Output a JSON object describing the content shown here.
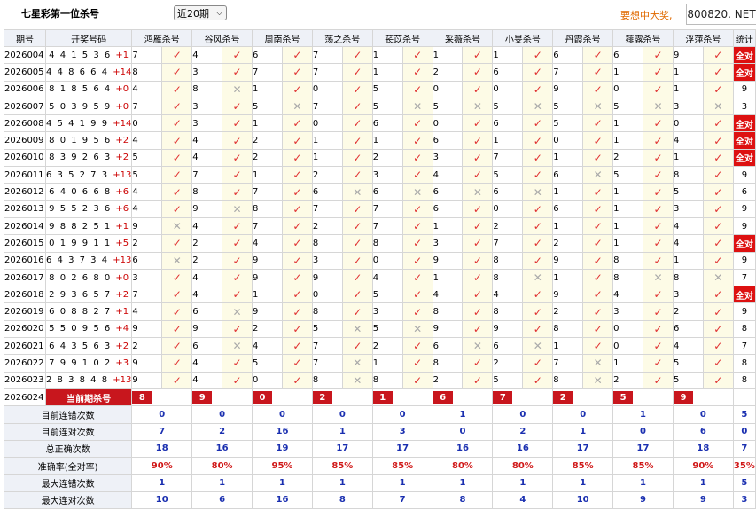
{
  "header": {
    "title": "七星彩第一位杀号",
    "period_select": "近20期",
    "ad_link": "要想中大奖,",
    "ad_badge": "800820. NET"
  },
  "columns": {
    "period": "期号",
    "draw": "开奖号码",
    "experts": [
      "鸿雁杀号",
      "谷风杀号",
      "周南杀号",
      "荡之杀号",
      "苌苡杀号",
      "采薇杀号",
      "小旻杀号",
      "丹霞杀号",
      "薤露杀号",
      "浮萍杀号"
    ],
    "stats": "统计"
  },
  "rows": [
    {
      "period": "2026004",
      "draw": "4 4 1 5 3 6",
      "plus": "+1",
      "nums": [
        7,
        4,
        6,
        7,
        1,
        1,
        1,
        6,
        6,
        9
      ],
      "marks": [
        1,
        1,
        1,
        1,
        1,
        1,
        1,
        1,
        1,
        1
      ],
      "stat": "全对"
    },
    {
      "period": "2026005",
      "draw": "4 4 8 6 6 4",
      "plus": "+14",
      "nums": [
        8,
        3,
        7,
        7,
        1,
        2,
        6,
        7,
        1,
        1
      ],
      "marks": [
        1,
        1,
        1,
        1,
        1,
        1,
        1,
        1,
        1,
        1
      ],
      "stat": "全对"
    },
    {
      "period": "2026006",
      "draw": "8 1 8 5 6 4",
      "plus": "+0",
      "nums": [
        4,
        8,
        1,
        0,
        5,
        0,
        0,
        9,
        0,
        1
      ],
      "marks": [
        1,
        0,
        1,
        1,
        1,
        1,
        1,
        1,
        1,
        1
      ],
      "stat": "9"
    },
    {
      "period": "2026007",
      "draw": "5 0 3 9 5 9",
      "plus": "+0",
      "nums": [
        7,
        3,
        5,
        7,
        5,
        5,
        5,
        5,
        5,
        3
      ],
      "marks": [
        1,
        1,
        0,
        1,
        0,
        0,
        0,
        0,
        0,
        0
      ],
      "stat": "3"
    },
    {
      "period": "2026008",
      "draw": "4 5 4 1 9 9",
      "plus": "+14",
      "nums": [
        0,
        3,
        1,
        0,
        6,
        0,
        6,
        5,
        1,
        0
      ],
      "marks": [
        1,
        1,
        1,
        1,
        1,
        1,
        1,
        1,
        1,
        1
      ],
      "stat": "全对"
    },
    {
      "period": "2026009",
      "draw": "8 0 1 9 5 6",
      "plus": "+2",
      "nums": [
        4,
        4,
        2,
        1,
        1,
        6,
        1,
        0,
        1,
        4
      ],
      "marks": [
        1,
        1,
        1,
        1,
        1,
        1,
        1,
        1,
        1,
        1
      ],
      "stat": "全对"
    },
    {
      "period": "2026010",
      "draw": "8 3 9 2 6 3",
      "plus": "+2",
      "nums": [
        5,
        4,
        2,
        1,
        2,
        3,
        7,
        1,
        2,
        1
      ],
      "marks": [
        1,
        1,
        1,
        1,
        1,
        1,
        1,
        1,
        1,
        1
      ],
      "stat": "全对"
    },
    {
      "period": "2026011",
      "draw": "6 3 5 2 7 3",
      "plus": "+13",
      "nums": [
        5,
        7,
        1,
        2,
        3,
        4,
        5,
        6,
        5,
        8
      ],
      "marks": [
        1,
        1,
        1,
        1,
        1,
        1,
        1,
        0,
        1,
        1
      ],
      "stat": "9"
    },
    {
      "period": "2026012",
      "draw": "6 4 0 6 6 8",
      "plus": "+6",
      "nums": [
        4,
        8,
        7,
        6,
        6,
        6,
        6,
        1,
        1,
        5
      ],
      "marks": [
        1,
        1,
        1,
        0,
        0,
        0,
        0,
        1,
        1,
        1
      ],
      "stat": "6"
    },
    {
      "period": "2026013",
      "draw": "9 5 5 2 3 6",
      "plus": "+6",
      "nums": [
        4,
        9,
        8,
        7,
        7,
        6,
        0,
        6,
        1,
        3
      ],
      "marks": [
        1,
        0,
        1,
        1,
        1,
        1,
        1,
        1,
        1,
        1
      ],
      "stat": "9"
    },
    {
      "period": "2026014",
      "draw": "9 8 8 2 5 1",
      "plus": "+1",
      "nums": [
        9,
        4,
        7,
        2,
        7,
        1,
        2,
        1,
        1,
        4
      ],
      "marks": [
        0,
        1,
        1,
        1,
        1,
        1,
        1,
        1,
        1,
        1
      ],
      "stat": "9"
    },
    {
      "period": "2026015",
      "draw": "0 1 9 9 1 1",
      "plus": "+5",
      "nums": [
        2,
        2,
        4,
        8,
        8,
        3,
        7,
        2,
        1,
        4
      ],
      "marks": [
        1,
        1,
        1,
        1,
        1,
        1,
        1,
        1,
        1,
        1
      ],
      "stat": "全对"
    },
    {
      "period": "2026016",
      "draw": "6 4 3 7 3 4",
      "plus": "+13",
      "nums": [
        6,
        2,
        9,
        3,
        0,
        9,
        8,
        9,
        8,
        1
      ],
      "marks": [
        0,
        1,
        1,
        1,
        1,
        1,
        1,
        1,
        1,
        1
      ],
      "stat": "9"
    },
    {
      "period": "2026017",
      "draw": "8 0 2 6 8 0",
      "plus": "+0",
      "nums": [
        3,
        4,
        9,
        9,
        4,
        1,
        8,
        1,
        8,
        8
      ],
      "marks": [
        1,
        1,
        1,
        1,
        1,
        1,
        0,
        1,
        0,
        0
      ],
      "stat": "7"
    },
    {
      "period": "2026018",
      "draw": "2 9 3 6 5 7",
      "plus": "+2",
      "nums": [
        7,
        4,
        1,
        0,
        5,
        4,
        4,
        9,
        4,
        3
      ],
      "marks": [
        1,
        1,
        1,
        1,
        1,
        1,
        1,
        1,
        1,
        1
      ],
      "stat": "全对"
    },
    {
      "period": "2026019",
      "draw": "6 0 8 8 2 7",
      "plus": "+1",
      "nums": [
        4,
        6,
        9,
        8,
        3,
        8,
        8,
        2,
        3,
        2
      ],
      "marks": [
        1,
        0,
        1,
        1,
        1,
        1,
        1,
        1,
        1,
        1
      ],
      "stat": "9"
    },
    {
      "period": "2026020",
      "draw": "5 5 0 9 5 6",
      "plus": "+4",
      "nums": [
        9,
        9,
        2,
        5,
        5,
        9,
        9,
        8,
        0,
        6
      ],
      "marks": [
        1,
        1,
        1,
        0,
        0,
        1,
        1,
        1,
        1,
        1
      ],
      "stat": "8"
    },
    {
      "period": "2026021",
      "draw": "6 4 3 5 6 3",
      "plus": "+2",
      "nums": [
        2,
        6,
        4,
        7,
        2,
        6,
        6,
        1,
        0,
        4
      ],
      "marks": [
        1,
        0,
        1,
        1,
        1,
        0,
        0,
        1,
        1,
        1
      ],
      "stat": "7"
    },
    {
      "period": "2026022",
      "draw": "7 9 9 1 0 2",
      "plus": "+3",
      "nums": [
        9,
        4,
        5,
        7,
        1,
        8,
        2,
        7,
        1,
        5
      ],
      "marks": [
        1,
        1,
        1,
        0,
        1,
        1,
        1,
        0,
        1,
        1
      ],
      "stat": "8"
    },
    {
      "period": "2026023",
      "draw": "2 8 3 8 4 8",
      "plus": "+13",
      "nums": [
        9,
        4,
        0,
        8,
        8,
        2,
        5,
        8,
        2,
        5
      ],
      "marks": [
        1,
        1,
        1,
        0,
        1,
        1,
        1,
        0,
        1,
        1
      ],
      "stat": "8"
    }
  ],
  "current": {
    "period": "2026024",
    "label": "当前期杀号",
    "nums": [
      8,
      9,
      0,
      2,
      1,
      6,
      7,
      2,
      5,
      9
    ]
  },
  "summary": [
    {
      "label": "目前连错次数",
      "values": [
        "0",
        "0",
        "0",
        "0",
        "0",
        "1",
        "0",
        "0",
        "1",
        "0"
      ],
      "stat": "5"
    },
    {
      "label": "目前连对次数",
      "values": [
        "7",
        "2",
        "16",
        "1",
        "3",
        "0",
        "2",
        "1",
        "0",
        "6"
      ],
      "stat": "0"
    },
    {
      "label": "总正确次数",
      "values": [
        "18",
        "16",
        "19",
        "17",
        "17",
        "16",
        "16",
        "17",
        "17",
        "18"
      ],
      "stat": "7"
    },
    {
      "label": "准确率(全对率)",
      "values": [
        "90%",
        "80%",
        "95%",
        "85%",
        "85%",
        "80%",
        "80%",
        "85%",
        "85%",
        "90%"
      ],
      "stat": "35%"
    },
    {
      "label": "最大连错次数",
      "values": [
        "1",
        "1",
        "1",
        "1",
        "1",
        "1",
        "1",
        "1",
        "1",
        "1"
      ],
      "stat": "5"
    },
    {
      "label": "最大连对次数",
      "values": [
        "10",
        "6",
        "16",
        "8",
        "7",
        "8",
        "4",
        "10",
        "9",
        "9"
      ],
      "stat": "3"
    }
  ],
  "marks": {
    "ok": "✓",
    "no": "✕"
  },
  "colors": {
    "accent": "#c8161d",
    "ok": "#e03030",
    "no_mark": "#aaaaaa",
    "link": "#e06a00",
    "sum_value": "#1a2fb0"
  }
}
